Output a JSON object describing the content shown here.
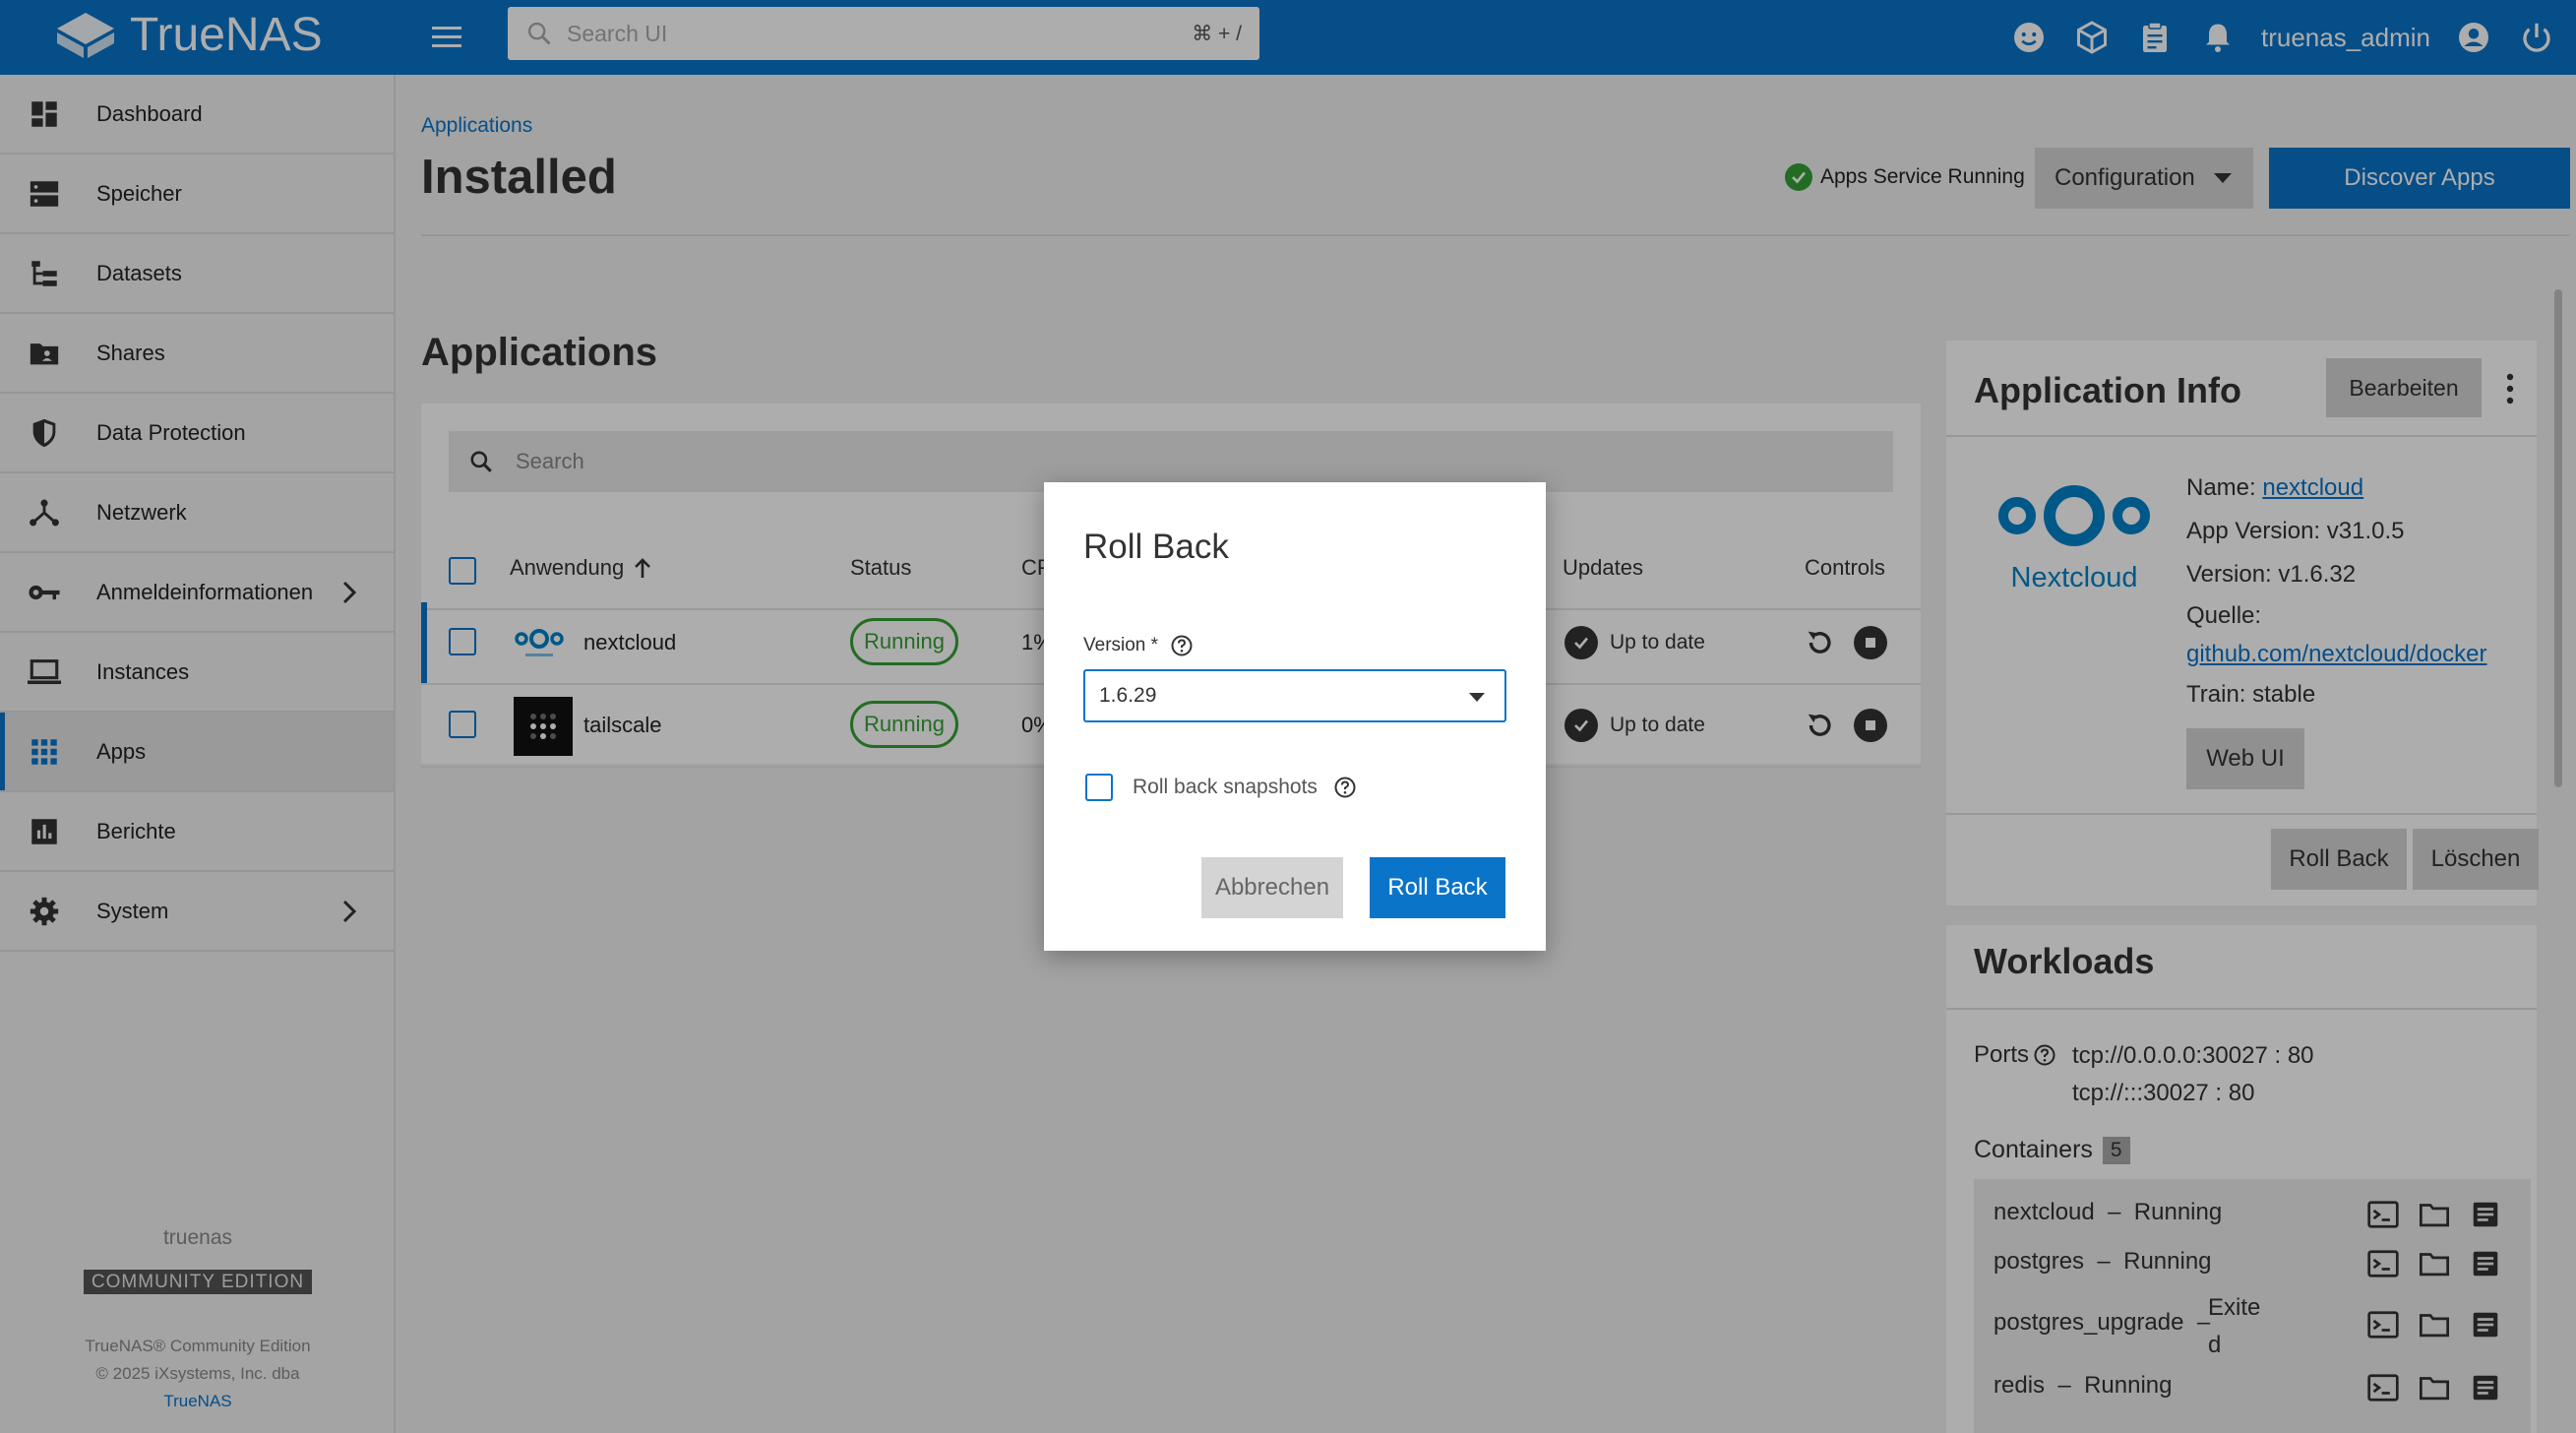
{
  "topbar": {
    "brand": "TrueNAS",
    "search_placeholder": "Search UI",
    "search_shortcut": "⌘ + /",
    "username": "truenas_admin",
    "bg_color": "#0a74c9"
  },
  "sidebar": {
    "items": [
      {
        "label": "Dashboard",
        "icon": "dashboard-icon"
      },
      {
        "label": "Speicher",
        "icon": "storage-icon"
      },
      {
        "label": "Datasets",
        "icon": "datasets-icon"
      },
      {
        "label": "Shares",
        "icon": "shares-folder-icon"
      },
      {
        "label": "Data Protection",
        "icon": "shield-icon"
      },
      {
        "label": "Netzwerk",
        "icon": "network-icon"
      },
      {
        "label": "Anmeldeinformationen",
        "icon": "key-icon"
      },
      {
        "label": "Instances",
        "icon": "laptop-icon"
      },
      {
        "label": "Apps",
        "icon": "apps-grid-icon"
      },
      {
        "label": "Berichte",
        "icon": "reports-chart-icon"
      },
      {
        "label": "System",
        "icon": "gear-icon"
      }
    ],
    "active": "Apps",
    "hostname": "truenas",
    "edition": "COMMUNITY EDITION",
    "copyright_line1": "TrueNAS® Community Edition",
    "copyright_line2": "© 2025 iXsystems, Inc. dba",
    "copyright_link": "TrueNAS"
  },
  "main": {
    "breadcrumb": "Applications",
    "title": "Installed",
    "service_status": "Apps Service Running",
    "config_button": "Configuration",
    "discover_button": "Discover Apps"
  },
  "apps": {
    "title": "Applications",
    "search_placeholder": "Search",
    "columns": {
      "name": "Anwendung",
      "status": "Status",
      "cpu": "CPU",
      "updates": "Updates",
      "controls": "Controls"
    },
    "rows": [
      {
        "name": "nextcloud",
        "status": "Running",
        "cpu": "1%",
        "updates": "Up to date"
      },
      {
        "name": "tailscale",
        "status": "Running",
        "cpu": "0%",
        "updates": "Up to date"
      }
    ]
  },
  "info": {
    "title": "Application Info",
    "edit_button": "Bearbeiten",
    "logo_text": "Nextcloud",
    "name_label": "Name:",
    "name_value": "nextcloud",
    "app_version": "App Version: v31.0.5",
    "version": "Version: v1.6.32",
    "source_label": "Quelle:",
    "source_value": "github.com/nextcloud/docker",
    "train": "Train: stable",
    "webui_button": "Web UI",
    "rollback_button": "Roll Back",
    "delete_button": "Löschen"
  },
  "workloads": {
    "title": "Workloads",
    "ports_label": "Ports",
    "ports": [
      "tcp://0.0.0.0:30027 : 80",
      "tcp://:::30027 : 80"
    ],
    "containers_label": "Containers",
    "containers_count": "5",
    "containers": [
      {
        "name": "nextcloud",
        "sep": "–",
        "state": "Running"
      },
      {
        "name": "postgres",
        "sep": "–",
        "state": "Running"
      },
      {
        "name": "postgres_upgrade",
        "sep": "–",
        "state_part1": "Exite",
        "state_part2": "d"
      },
      {
        "name": "redis",
        "sep": "–",
        "state": "Running"
      }
    ]
  },
  "dialog": {
    "title": "Roll Back",
    "version_label": "Version *",
    "version_value": "1.6.29",
    "snapshots_label": "Roll back snapshots",
    "cancel_button": "Abbrechen",
    "confirm_button": "Roll Back"
  }
}
